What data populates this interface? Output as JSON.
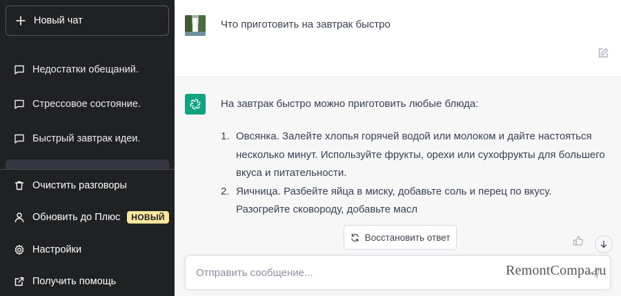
{
  "sidebar": {
    "new_chat_label": "Новый чат",
    "conversations": [
      {
        "label": "Недостатки обещаний."
      },
      {
        "label": "Стрессовое состояние."
      },
      {
        "label": "Быстрый завтрак идеи."
      }
    ],
    "bottom": {
      "clear_label": "Очистить разговоры",
      "upgrade_label": "Обновить до Плюс",
      "upgrade_badge": "НОВЫЙ",
      "settings_label": "Настройки",
      "help_label": "Получить помощь"
    }
  },
  "chat": {
    "user_message": "Что приготовить на завтрак быстро",
    "bot_intro": "На завтрак быстро можно приготовить любые блюда:",
    "bot_items": [
      {
        "num": "1.",
        "text": "Овсянка. Залейте хлопья горячей водой или молоком и дайте настояться несколько минут. Используйте фрукты, орехи или сухофрукты для большего вкуса и питательности."
      },
      {
        "num": "2.",
        "text": "Яичница. Разбейте яйца в миску, добавьте соль и перец по вкусу. Разогрейте сковороду, добавьте масл"
      }
    ],
    "regenerate_label": "Восстановить ответ",
    "input_placeholder": "Отправить сообщение..."
  },
  "watermark": "RemontCompa.ru",
  "colors": {
    "sidebar_bg": "#202123",
    "bot_avatar": "#10a37f",
    "badge_bg": "#fae69e",
    "bot_row_bg": "#f7f7f8"
  }
}
